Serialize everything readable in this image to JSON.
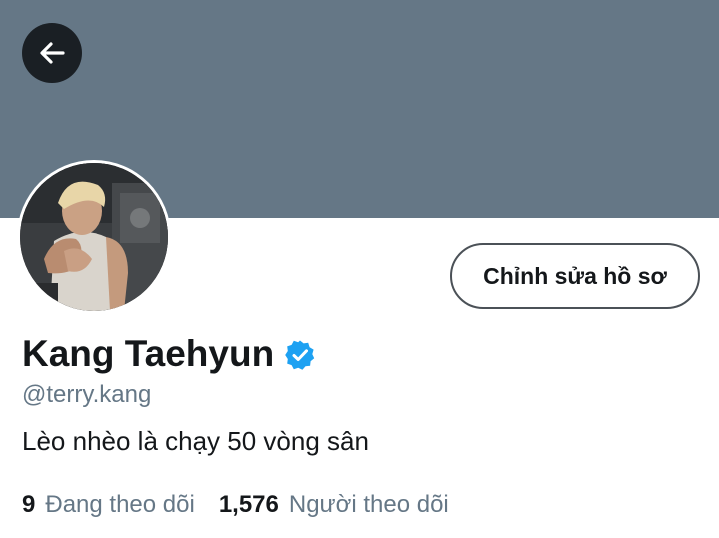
{
  "profile": {
    "display_name": "Kang Taehyun",
    "verified": true,
    "handle": "@terry.kang",
    "bio": "Lèo nhèo là chạy 50 vòng sân"
  },
  "actions": {
    "edit_profile_label": "Chỉnh sửa hồ sơ",
    "back_icon": "arrow-left-icon"
  },
  "stats": {
    "following_count": "9",
    "following_label": "Đang theo dõi",
    "followers_count": "1,576",
    "followers_label": "Người theo dõi"
  },
  "colors": {
    "banner": "#657786",
    "accent_blue": "#1da1f2",
    "text_primary": "#14171a",
    "text_secondary": "#657786"
  }
}
